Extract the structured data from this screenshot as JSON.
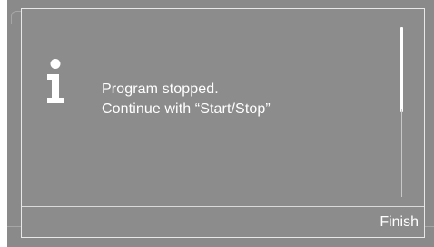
{
  "dialog": {
    "icon": "info-icon",
    "message_lines": [
      "Program stopped.",
      "Continue with “Start/Stop”"
    ],
    "finish_label": "Finish"
  },
  "colors": {
    "background": "#8a8a8a",
    "dialog_background": "#8c8c8c",
    "border": "#e8e8e8",
    "text": "#ffffff"
  }
}
